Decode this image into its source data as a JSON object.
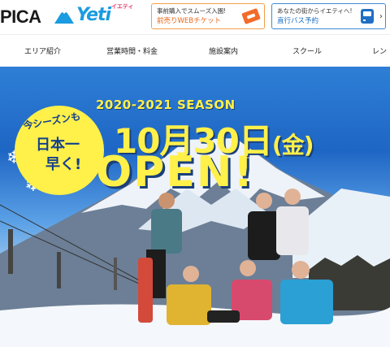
{
  "header": {
    "logo_brand": "PICA",
    "logo_yeti": "Yeti",
    "logo_yeti_kana": "イエティ",
    "promo_ticket": {
      "small": "事前購入でスムーズ入園!",
      "big": "前売りWEBチケット",
      "icon": "ticket-icon"
    },
    "promo_bus": {
      "small": "あなたの街からイエティへ!",
      "big": "直行バス予約",
      "icon": "bus-icon",
      "chevron": "›"
    }
  },
  "nav": {
    "items": [
      "エリア紹介",
      "営業時間・料金",
      "施設案内",
      "スクール",
      "レン"
    ]
  },
  "hero": {
    "season": "2020-2021 SEASON",
    "bubble": {
      "line1": "今シーズンも",
      "line2": "日本一",
      "line3": "早く!"
    },
    "date_day": "10月30日",
    "date_dow": "(金)",
    "open": "OPEN!",
    "colors": {
      "accent_yellow": "#fff04a",
      "navy": "#14408c",
      "sky": "#1e66c4"
    }
  }
}
